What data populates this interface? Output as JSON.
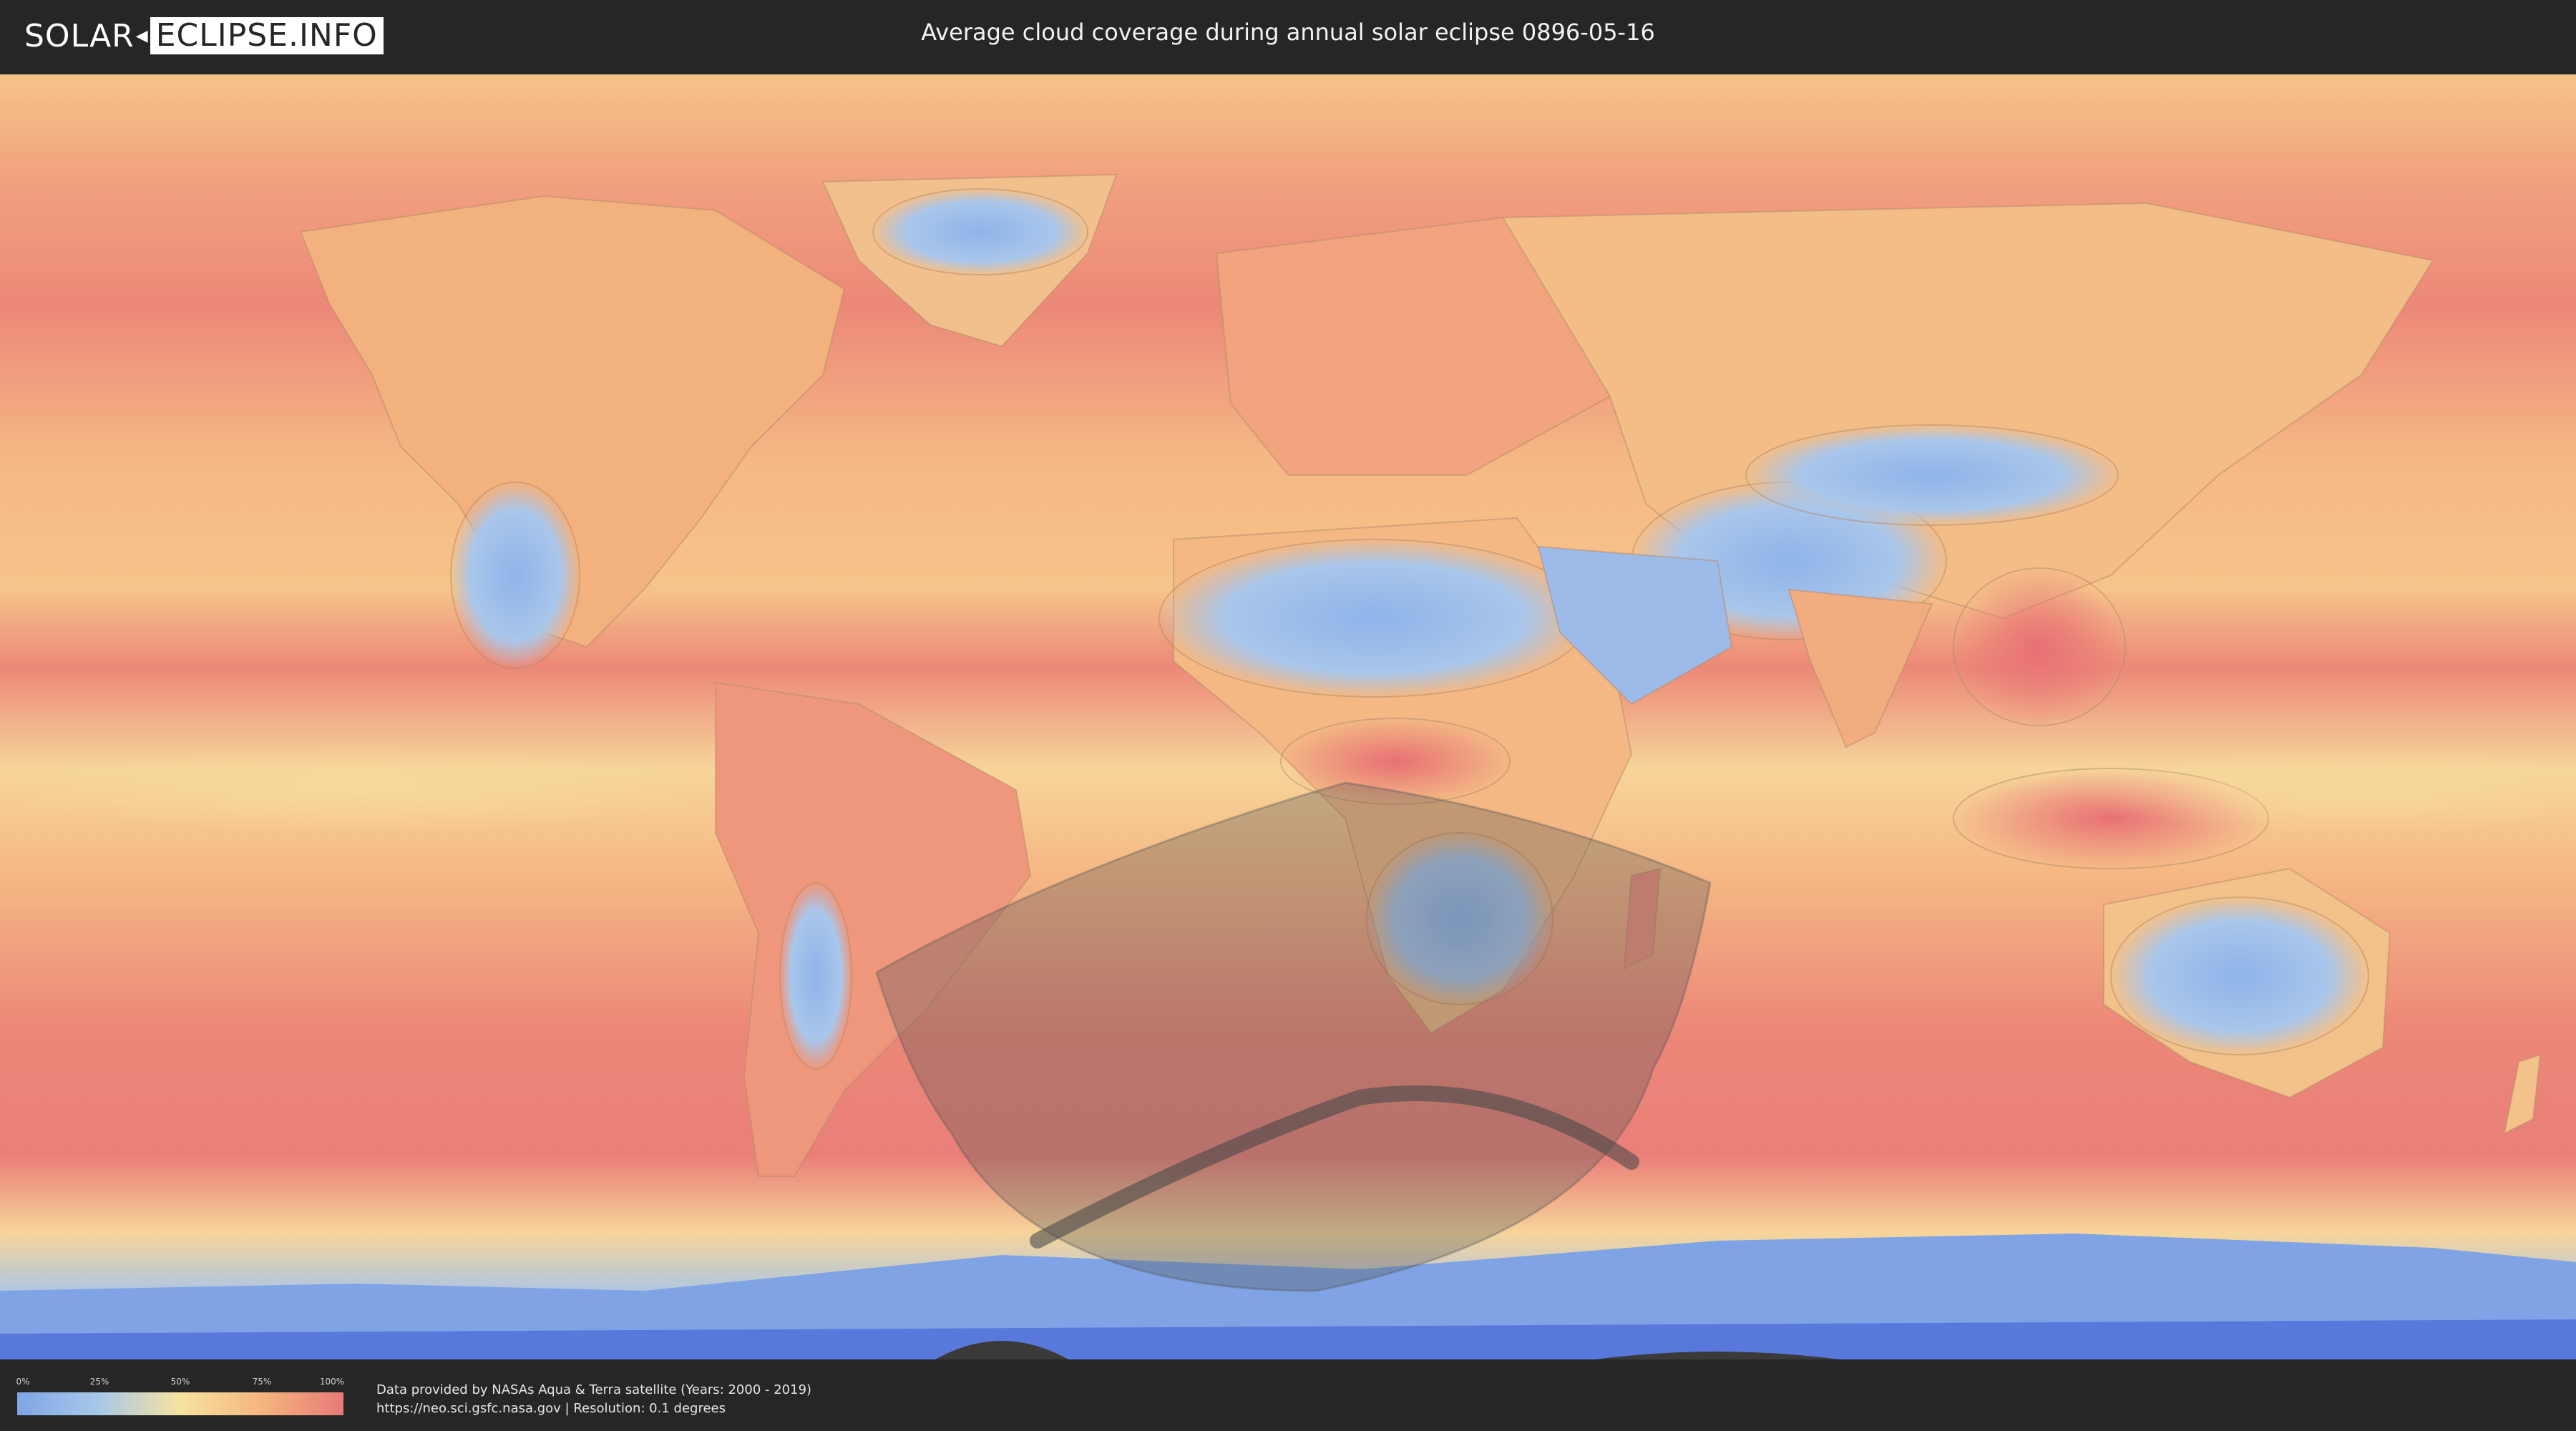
{
  "header": {
    "logo_left": "SOLAR",
    "logo_right": "ECLIPSE.INFO",
    "title": "Average cloud coverage during annual solar eclipse 0896-05-16"
  },
  "legend": {
    "ticks": [
      "0%",
      "25%",
      "50%",
      "75%",
      "100%"
    ],
    "colors": [
      "#7fa6e6",
      "#a8c8e8",
      "#f7e3a0",
      "#f4b57e",
      "#e87a78"
    ]
  },
  "credits": {
    "line1": "Data provided by NASAs Aqua & Terra satellite (Years: 2000 - 2019)",
    "line2": "https://neo.sci.gsfc.nasa.gov | Resolution: 0.1 degrees"
  },
  "map": {
    "background_colors": {
      "ocean_cloudy": "#ed8a78",
      "mid_cloud": "#f6c48a",
      "low_cloud": "#8eb4ea",
      "polar_ice": "#5b82e0"
    },
    "eclipse_shadow_color": "#555555"
  }
}
